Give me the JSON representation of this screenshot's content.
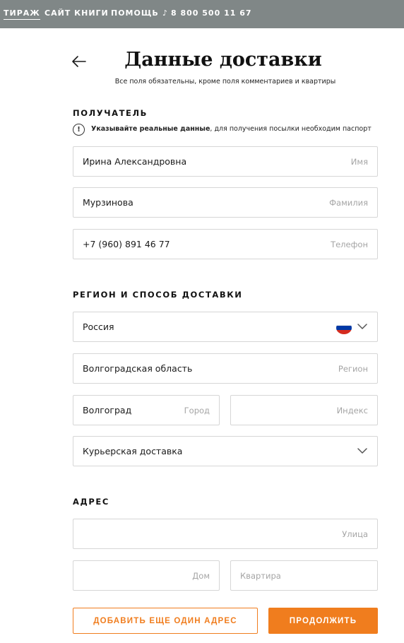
{
  "nav": {
    "items": [
      "ТИРАЖ",
      "САЙТ КНИГИ",
      "ПОМОЩЬ"
    ],
    "phone": "8 800 500 11 67",
    "phone_icon": "phone-icon"
  },
  "header": {
    "title": "Данные доставки",
    "subtitle": "Все поля обязательны, кроме поля комментариев и квартиры",
    "back_icon": "arrow-left-icon"
  },
  "recipient": {
    "section_title": "ПОЛУЧАТЕЛЬ",
    "notice_strong": "Указывайте реальные данные",
    "notice_text": ", для получения посылки необходим паспорт",
    "notice_icon": "info-icon",
    "first_name": {
      "value": "Ирина Александровна",
      "label": "Имя"
    },
    "last_name": {
      "value": "Мурзинова",
      "label": "Фамилия"
    },
    "phone": {
      "value": "+7 (960) 891 46 77",
      "label": "Телефон"
    }
  },
  "delivery": {
    "section_title": "РЕГИОН И СПОСОБ ДОСТАВКИ",
    "country": {
      "value": "Россия",
      "flag_icon": "russia-flag-icon",
      "flag_colors": [
        "#ffffff",
        "#0039a6",
        "#d52b1e"
      ]
    },
    "region": {
      "value": "Волгоградская область",
      "label": "Регион"
    },
    "city": {
      "value": "Волгоград",
      "label": "Город"
    },
    "postal_code": {
      "value": "",
      "label": "Индекс"
    },
    "method": {
      "value": "Курьерская доставка"
    }
  },
  "address": {
    "section_title": "АДРЕС",
    "street": {
      "value": "",
      "label": "Улица"
    },
    "house": {
      "value": "",
      "label": "Дом"
    },
    "apartment": {
      "value": "",
      "label": "Квартира"
    }
  },
  "actions": {
    "add_address_label": "ДОБАВИТЬ ЕЩЕ ОДИН АДРЕС",
    "continue_label": "ПРОДОЛЖИТЬ"
  },
  "colors": {
    "topbar": "#808787",
    "accent": "#f07d1e",
    "border": "#d6d6d6",
    "placeholder": "#a5a5a5"
  }
}
